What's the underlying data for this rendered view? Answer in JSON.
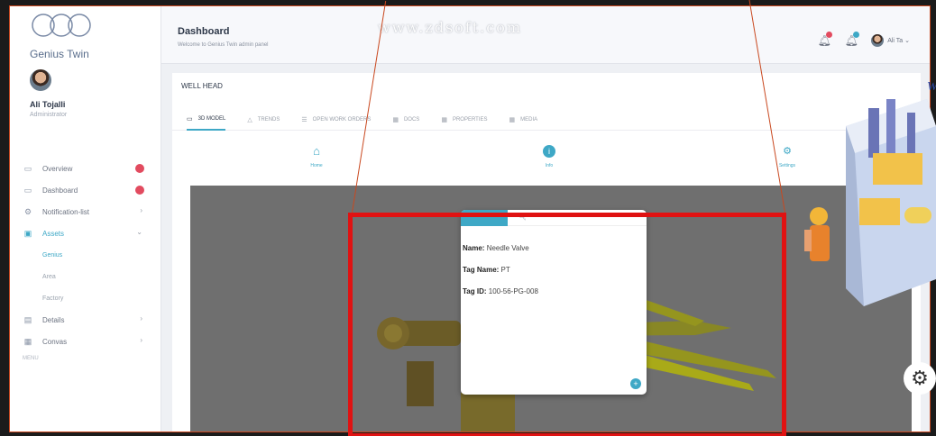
{
  "app": {
    "logo_text": "Genius Twin",
    "watermark": "www.zdsoft.com"
  },
  "user": {
    "name": "Ali Tojalli",
    "role": "Administrator"
  },
  "sidebar": {
    "items": [
      {
        "label": "Overview",
        "icon": "monitor-icon",
        "badge": true
      },
      {
        "label": "Dashboard",
        "icon": "monitor-icon",
        "badge": true
      },
      {
        "label": "Notification-list",
        "icon": "gear-icon",
        "chevron": "›"
      },
      {
        "label": "Assets",
        "icon": "box-icon",
        "chevron": "⌄",
        "active": true
      }
    ],
    "sub_items": [
      {
        "label": "Genius",
        "active": true
      },
      {
        "label": "Area"
      },
      {
        "label": "Factory"
      }
    ],
    "items_after": [
      {
        "label": "Details",
        "icon": "calendar-icon",
        "chevron": "›"
      },
      {
        "label": "Convas",
        "icon": "table-icon",
        "chevron": "›"
      }
    ],
    "footer": "MENU"
  },
  "header": {
    "title": "Dashboard",
    "subtitle": "Welcome to Genius Twin admin panel",
    "username": "Ali Ta",
    "notification_colors": [
      "#e24b5f",
      "#3ea8c6"
    ]
  },
  "card": {
    "title": "WELL HEAD",
    "tabs": [
      {
        "label": "3D MODEL",
        "icon": "monitor-icon",
        "active": true
      },
      {
        "label": "TRENDS",
        "icon": "triangle-icon"
      },
      {
        "label": "OPEN WORK ORDERS",
        "icon": "list-icon"
      },
      {
        "label": "DOCS",
        "icon": "grid-icon"
      },
      {
        "label": "PROPERTIES",
        "icon": "grid-icon"
      },
      {
        "label": "MEDIA",
        "icon": "grid-icon"
      }
    ],
    "tools": [
      {
        "label": "Home",
        "icon": "home-icon"
      },
      {
        "label": "Info",
        "icon": "info-icon"
      },
      {
        "label": "Settings",
        "icon": "settings-icon"
      }
    ]
  },
  "popup": {
    "rows": [
      {
        "label": "Name:",
        "value": "Needle Valve"
      },
      {
        "label": "Tag Name:",
        "value": "PT"
      },
      {
        "label": "Tag ID:",
        "value": "100-56-PG-008"
      }
    ]
  },
  "accent": "#3ea8c6",
  "highlight_color": "#e01212"
}
